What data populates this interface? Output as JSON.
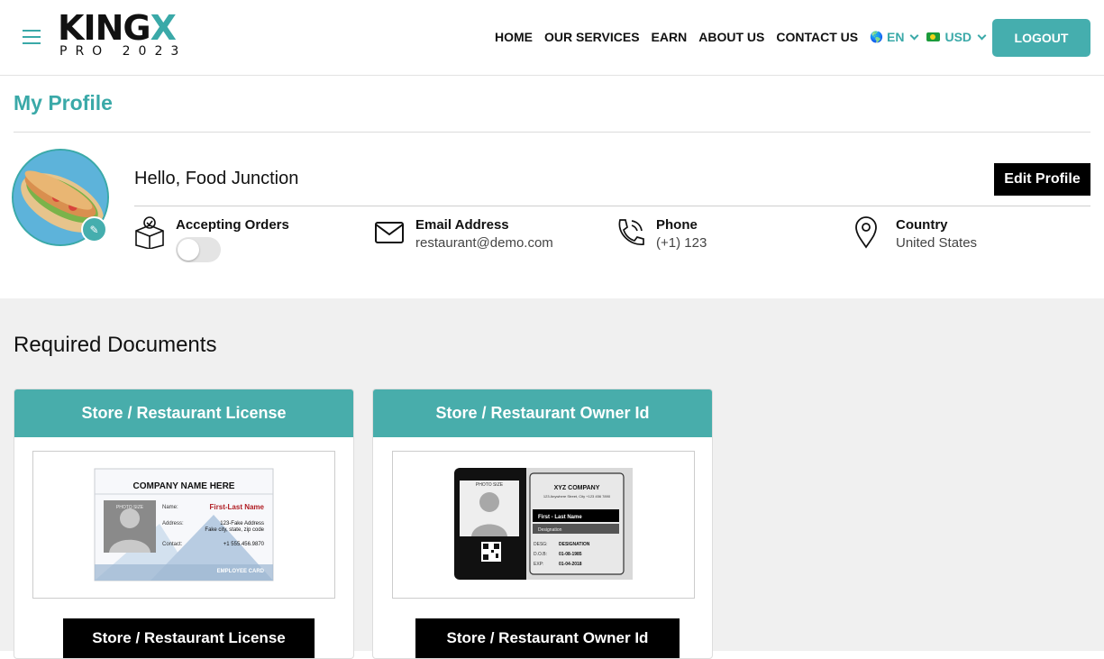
{
  "brand": {
    "name_main": "KING",
    "name_accent": "X",
    "tagline": "PRO 2023"
  },
  "nav": {
    "items": [
      "HOME",
      "OUR SERVICES",
      "EARN",
      "ABOUT US",
      "CONTACT US"
    ],
    "language": "EN",
    "currency": "USD",
    "logout_label": "LOGOUT"
  },
  "profile": {
    "title": "My Profile",
    "greeting": "Hello, Food Junction",
    "edit_label": "Edit Profile",
    "accepting_orders_label": "Accepting Orders",
    "accepting_orders": false,
    "email_label": "Email Address",
    "email_value": "restaurant@demo.com",
    "phone_label": "Phone",
    "phone_value": "(+1) 123",
    "country_label": "Country",
    "country_value": "United States"
  },
  "documents": {
    "title": "Required Documents",
    "cards": [
      {
        "header": "Store / Restaurant License",
        "button": "Store / Restaurant License"
      },
      {
        "header": "Store / Restaurant Owner Id",
        "button": "Store / Restaurant Owner Id"
      }
    ],
    "license_card": {
      "company": "COMPANY NAME HERE",
      "photo_text": "PHOTO SIZE",
      "name_label": "Name:",
      "name_value": "First-Last Name",
      "address_label": "Address:",
      "address_line1": "123-Fake Address",
      "address_line2": "Fake city, state, zip code",
      "contact_label": "Contact:",
      "contact_value": "+1 555.456.9870",
      "footer": "EMPLOYEE CARD"
    },
    "owner_card": {
      "photo_text": "PHOTO SIZE",
      "company": "XYZ COMPANY",
      "address": "123 Anywhere Street, City +123 456 7890",
      "name": "First - Last Name",
      "designation": "Designation",
      "desg_label": "DESG:",
      "desg_value": "DESIGNATION",
      "dob_label": "D.O.B:",
      "dob_value": "01-08-1985",
      "exp_label": "EXP:",
      "exp_value": "01-04-2018"
    }
  },
  "colors": {
    "accent": "#3aa9a8",
    "button_dark": "#000000",
    "section_bg": "#f0f0f0"
  }
}
